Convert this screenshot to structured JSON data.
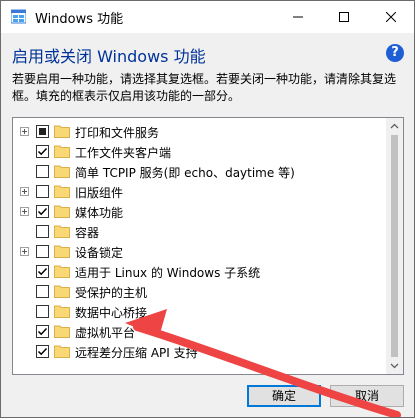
{
  "window": {
    "title": "Windows 功能",
    "controls": {
      "minimize": "minimize",
      "maximize": "maximize",
      "close": "close"
    }
  },
  "header": {
    "heading": "启用或关闭 Windows 功能",
    "help": "?",
    "description": "若要启用一种功能，请选择其复选框。若要关闭一种功能，请清除其复选框。填充的框表示仅启用该功能的一部分。"
  },
  "features": [
    {
      "label": "打印和文件服务",
      "state": "partial",
      "expandable": true
    },
    {
      "label": "工作文件夹客户端",
      "state": "checked",
      "expandable": false
    },
    {
      "label": "简单 TCPIP 服务(即 echo、daytime 等)",
      "state": "unchecked",
      "expandable": false
    },
    {
      "label": "旧版组件",
      "state": "unchecked",
      "expandable": true
    },
    {
      "label": "媒体功能",
      "state": "checked",
      "expandable": true
    },
    {
      "label": "容器",
      "state": "unchecked",
      "expandable": false
    },
    {
      "label": "设备锁定",
      "state": "unchecked",
      "expandable": true
    },
    {
      "label": "适用于 Linux 的 Windows 子系统",
      "state": "checked",
      "expandable": false
    },
    {
      "label": "受保护的主机",
      "state": "unchecked",
      "expandable": false
    },
    {
      "label": "数据中心桥接",
      "state": "unchecked",
      "expandable": false
    },
    {
      "label": "虚拟机平台",
      "state": "checked",
      "expandable": false
    },
    {
      "label": "远程差分压缩 API 支持",
      "state": "checked",
      "expandable": false
    }
  ],
  "buttons": {
    "ok": "确定",
    "cancel": "取消"
  },
  "colors": {
    "heading": "#003399",
    "folder": "#f8d775",
    "help": "#1f5fd6",
    "annotation": "#ee4444"
  }
}
